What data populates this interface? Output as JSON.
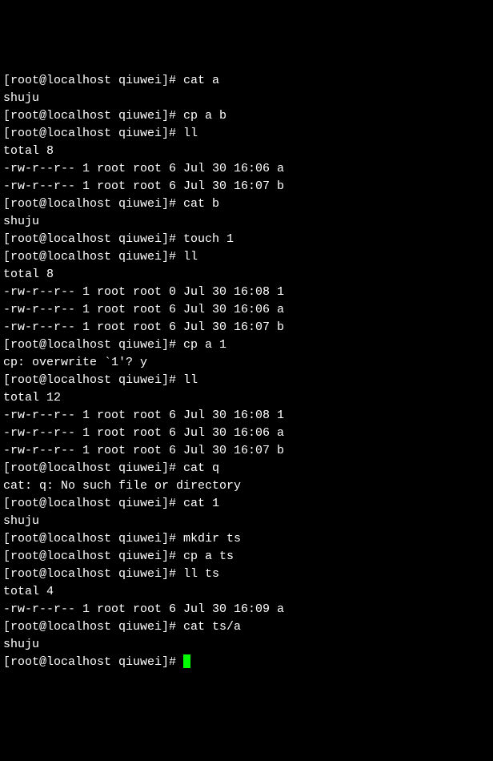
{
  "prompt": "[root@localhost qiuwei]# ",
  "lines": [
    {
      "type": "cmd",
      "text": "cat a"
    },
    {
      "type": "out",
      "text": "shuju"
    },
    {
      "type": "cmd",
      "text": "cp a b"
    },
    {
      "type": "cmd",
      "text": "ll"
    },
    {
      "type": "out",
      "text": "total 8"
    },
    {
      "type": "out",
      "text": "-rw-r--r-- 1 root root 6 Jul 30 16:06 a"
    },
    {
      "type": "out",
      "text": "-rw-r--r-- 1 root root 6 Jul 30 16:07 b"
    },
    {
      "type": "cmd",
      "text": "cat b"
    },
    {
      "type": "out",
      "text": "shuju"
    },
    {
      "type": "cmd",
      "text": "touch 1"
    },
    {
      "type": "cmd",
      "text": "ll"
    },
    {
      "type": "out",
      "text": "total 8"
    },
    {
      "type": "out",
      "text": "-rw-r--r-- 1 root root 0 Jul 30 16:08 1"
    },
    {
      "type": "out",
      "text": "-rw-r--r-- 1 root root 6 Jul 30 16:06 a"
    },
    {
      "type": "out",
      "text": "-rw-r--r-- 1 root root 6 Jul 30 16:07 b"
    },
    {
      "type": "cmd",
      "text": "cp a 1"
    },
    {
      "type": "out",
      "text": "cp: overwrite `1'? y"
    },
    {
      "type": "cmd",
      "text": "ll"
    },
    {
      "type": "out",
      "text": "total 12"
    },
    {
      "type": "out",
      "text": "-rw-r--r-- 1 root root 6 Jul 30 16:08 1"
    },
    {
      "type": "out",
      "text": "-rw-r--r-- 1 root root 6 Jul 30 16:06 a"
    },
    {
      "type": "out",
      "text": "-rw-r--r-- 1 root root 6 Jul 30 16:07 b"
    },
    {
      "type": "cmd",
      "text": "cat q"
    },
    {
      "type": "out",
      "text": "cat: q: No such file or directory"
    },
    {
      "type": "cmd",
      "text": "cat 1"
    },
    {
      "type": "out",
      "text": "shuju"
    },
    {
      "type": "cmd",
      "text": "mkdir ts"
    },
    {
      "type": "cmd",
      "text": "cp a ts"
    },
    {
      "type": "cmd",
      "text": "ll ts"
    },
    {
      "type": "out",
      "text": "total 4"
    },
    {
      "type": "out",
      "text": "-rw-r--r-- 1 root root 6 Jul 30 16:09 a"
    },
    {
      "type": "cmd",
      "text": "cat ts/a"
    },
    {
      "type": "out",
      "text": "shuju"
    },
    {
      "type": "cmd-cursor",
      "text": ""
    }
  ]
}
